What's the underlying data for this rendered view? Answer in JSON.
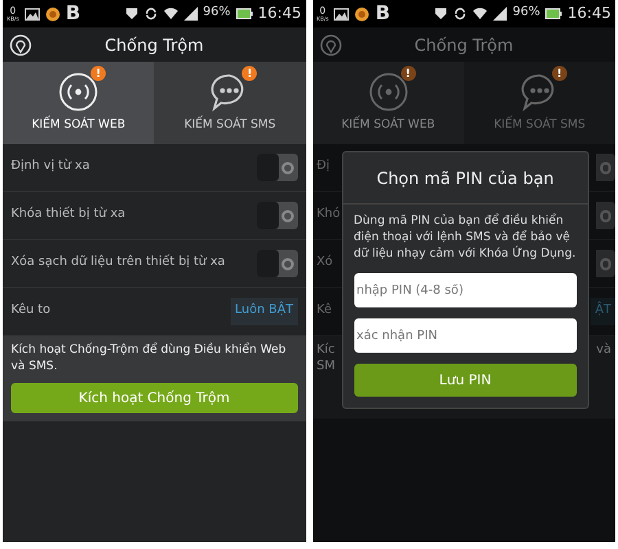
{
  "screens": [
    {
      "dimmed": false,
      "status_bar": {
        "speed": "0",
        "speed_unit": "KB/s",
        "app_letter": "B",
        "battery": "96%",
        "time": "16:45"
      },
      "header": {
        "title": "Chống Trộm"
      },
      "tabs": [
        {
          "kind": "web",
          "label": "KIẾM SOÁT WEB",
          "selected": true,
          "badge": "!"
        },
        {
          "kind": "sms",
          "label": "KIẾM SOÁT SMS",
          "selected": false,
          "badge": "!"
        }
      ],
      "settings": [
        {
          "kind": "toggle",
          "label": "Định vị từ xa",
          "on": false
        },
        {
          "kind": "toggle",
          "label": "Khóa thiết bị từ xa",
          "on": false
        },
        {
          "kind": "toggle",
          "label": "Xóa sạch dữ liệu trên thiết bị từ xa",
          "on": false
        },
        {
          "kind": "value",
          "label": "Kêu to",
          "value": "Luôn BẬT"
        }
      ],
      "info": {
        "text": "Kích hoạt Chống-Trộm để dùng Điều khiển Web và SMS.",
        "button": "Kích hoạt Chống Trộm"
      }
    },
    {
      "dimmed": true,
      "status_bar": {
        "speed": "0",
        "speed_unit": "KB/s",
        "app_letter": "B",
        "battery": "96%",
        "time": "16:45"
      },
      "header": {
        "title": "Chống Trộm"
      },
      "tabs": [
        {
          "kind": "web",
          "label": "KIẾM SOÁT WEB",
          "selected": true,
          "badge": "!"
        },
        {
          "kind": "sms",
          "label": "KIẾM SOÁT SMS",
          "selected": false,
          "badge": "!"
        }
      ],
      "settings": [
        {
          "kind": "toggle",
          "label": "Đị",
          "on": false
        },
        {
          "kind": "toggle",
          "label": "Khó",
          "on": false
        },
        {
          "kind": "toggle",
          "label": "Xó",
          "on": false
        },
        {
          "kind": "value",
          "label": "Kê",
          "value": "ẬT"
        }
      ],
      "info": {
        "text_left": [
          "Kíc",
          "SM"
        ],
        "text_right": "và"
      },
      "dialog": {
        "title": "Chọn mã PIN của bạn",
        "message": "Dùng mã PIN của bạn để điều khiển điện thoại với lệnh SMS và để bảo vệ dữ liệu nhạy cảm với Khóa Ứng Dụng.",
        "fields": [
          {
            "placeholder": "nhập PIN (4-8 số)"
          },
          {
            "placeholder": "xác nhận PIN"
          }
        ],
        "button": "Lưu PIN"
      }
    }
  ]
}
